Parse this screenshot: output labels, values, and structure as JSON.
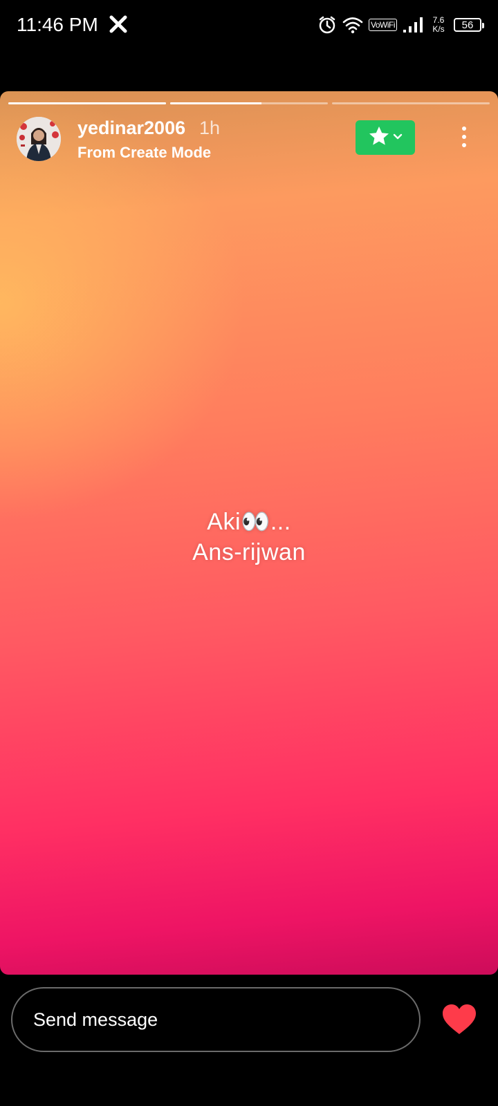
{
  "status_bar": {
    "time": "11:46 PM",
    "vowifi": "VoWiFi",
    "net_speed_value": "7.6",
    "net_speed_unit": "K/s",
    "battery": "56"
  },
  "story": {
    "progress": [
      1.0,
      0.58,
      0.0
    ],
    "username": "yedinar2006",
    "time_ago": "1h",
    "subtitle": "From Create Mode",
    "text_line1": "Aki👀...",
    "text_line2": "Ans-rijwan",
    "favorite_color": "#22c55e"
  },
  "composer": {
    "placeholder": "Send message",
    "like_color": "#fe3b4a"
  }
}
